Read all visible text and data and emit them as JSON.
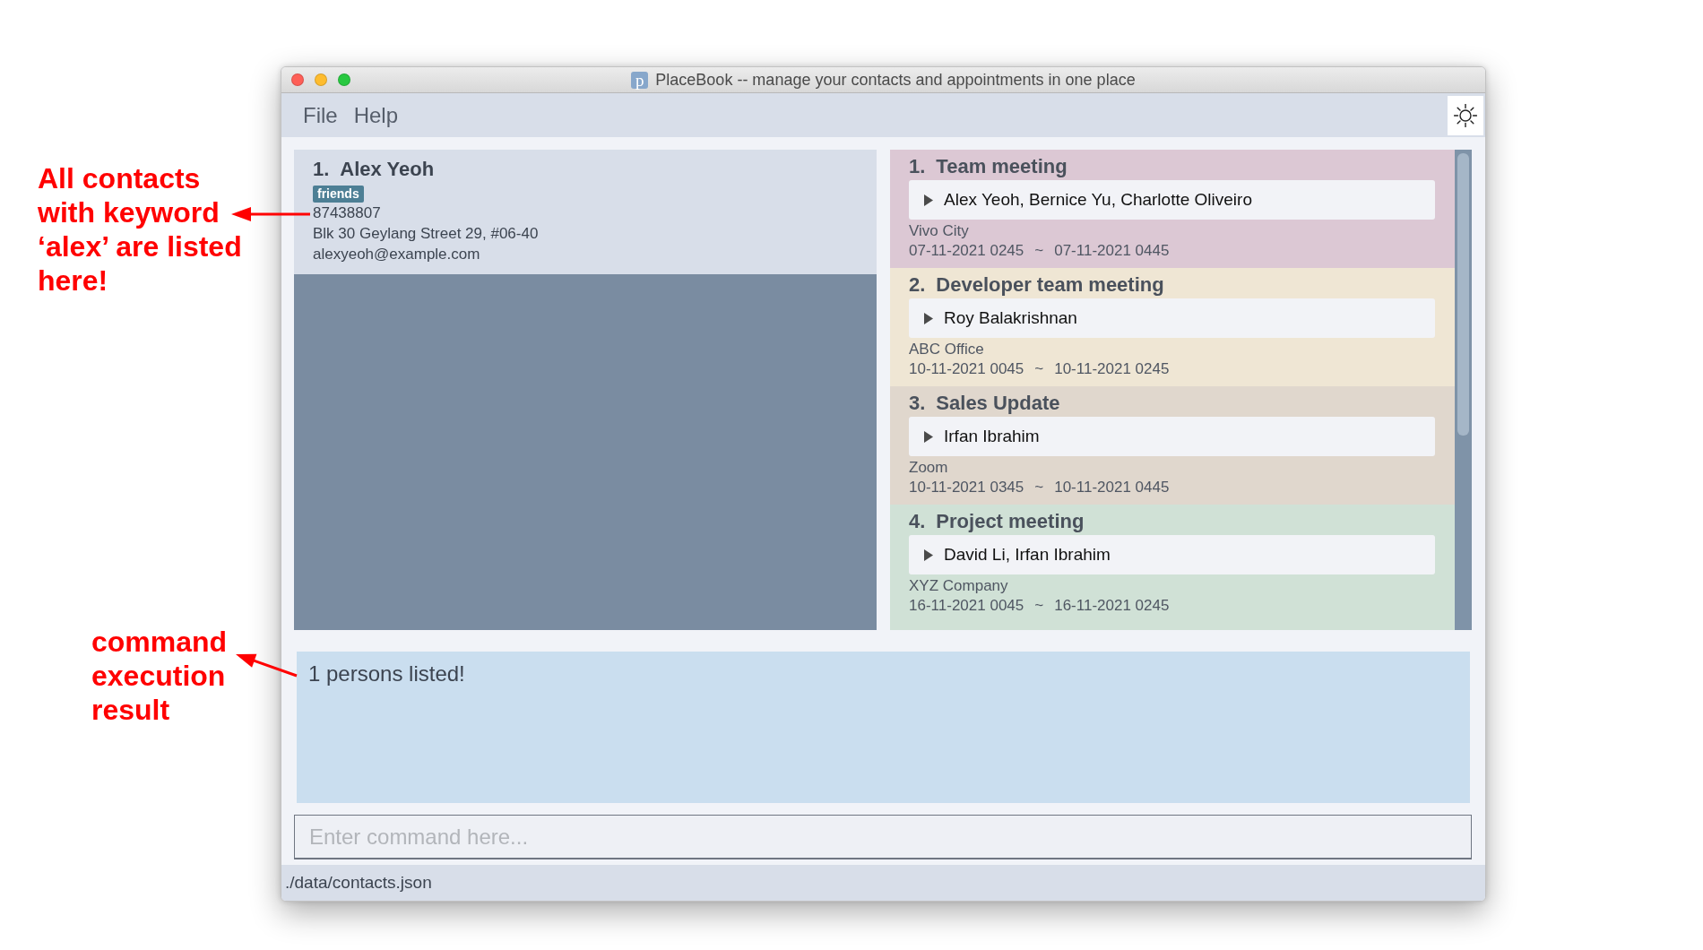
{
  "window": {
    "title": "PlaceBook -- manage your contacts and appointments in one place",
    "icon_letter": "p"
  },
  "menu": [
    {
      "label": "File"
    },
    {
      "label": "Help"
    }
  ],
  "contacts": [
    {
      "index": "1.",
      "name": "Alex Yeoh",
      "tags": [
        "friends"
      ],
      "phone": "87438807",
      "address": "Blk 30 Geylang Street 29, #06-40",
      "email": "alexyeoh@example.com"
    }
  ],
  "appointments": [
    {
      "index": "1.",
      "title": "Team meeting",
      "color": "#dcc8d4",
      "participants": "Alex Yeoh, Bernice Yu, Charlotte Oliveiro",
      "expanded": false,
      "location": "Vivo City",
      "start": "07-11-2021 0245",
      "separator": "~",
      "end": "07-11-2021 0445"
    },
    {
      "index": "2.",
      "title": "Developer team meeting",
      "color": "#efe6d4",
      "participants": "Roy Balakrishnan",
      "expanded": false,
      "location": "ABC Office",
      "start": "10-11-2021 0045",
      "separator": "~",
      "end": "10-11-2021 0245"
    },
    {
      "index": "3.",
      "title": "Sales Update",
      "color": "#e0d7cd",
      "participants": "Irfan Ibrahim",
      "expanded": false,
      "location": "Zoom",
      "start": "10-11-2021 0345",
      "separator": "~",
      "end": "10-11-2021 0445"
    },
    {
      "index": "4.",
      "title": "Project meeting",
      "color": "#d0e1d6",
      "participants": "David Li, Irfan Ibrahim",
      "expanded": false,
      "location": "XYZ Company",
      "start": "16-11-2021 0045",
      "separator": "~",
      "end": "16-11-2021 0245"
    }
  ],
  "result": {
    "message": "1 persons listed!"
  },
  "command_box": {
    "placeholder": "Enter command here..."
  },
  "status_bar": {
    "path": "./data/contacts.json"
  },
  "annotations": [
    {
      "text": "All contacts with keyword ‘alex’ are listed here!"
    },
    {
      "text": "command execution result"
    }
  ]
}
